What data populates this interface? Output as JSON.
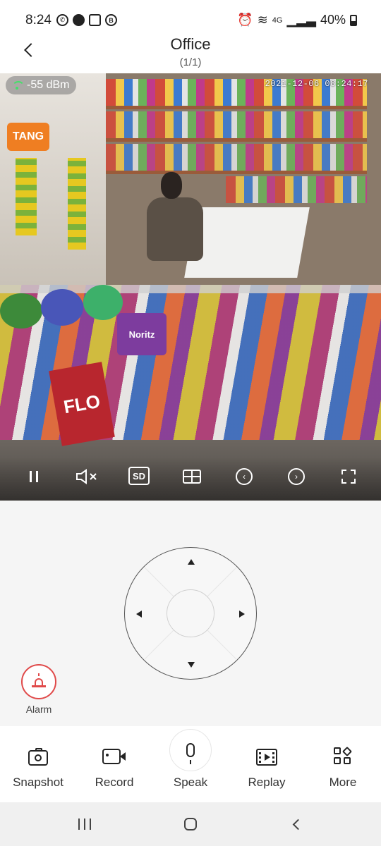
{
  "status_bar": {
    "time": "8:24",
    "network": "4G",
    "battery": "40%"
  },
  "header": {
    "title": "Office",
    "subtitle": "(1/1)"
  },
  "video": {
    "signal": "-55 dBm",
    "timestamp": "2021-12-06 08:24:17",
    "overlay_text": {
      "tang": "TANG",
      "flo": "FLO",
      "noritz": "Noritz"
    },
    "controls": {
      "quality": "SD"
    }
  },
  "ptz": {
    "alarm_label": "Alarm"
  },
  "toolbar": {
    "snapshot": "Snapshot",
    "record": "Record",
    "speak": "Speak",
    "replay": "Replay",
    "more": "More"
  },
  "colors": {
    "alarm_red": "#e04a4a",
    "signal_green": "#45e06a"
  }
}
